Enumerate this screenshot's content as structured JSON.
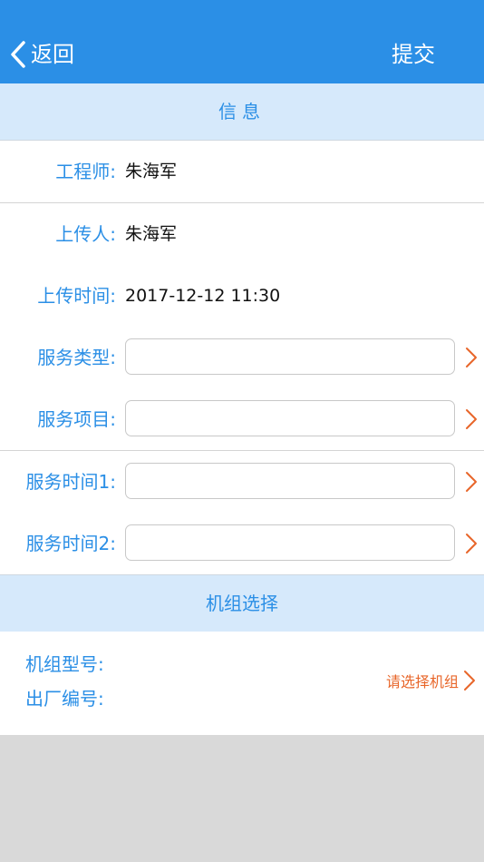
{
  "navbar": {
    "back_label": "返回",
    "submit_label": "提交"
  },
  "sections": {
    "info_title": "信息",
    "unit_title": "机组选择"
  },
  "info_rows": [
    {
      "label": "工程师:",
      "value": "朱海军"
    },
    {
      "label": "上传人:",
      "value": "朱海军"
    },
    {
      "label": "上传时间:",
      "value": "2017-12-12 11:30"
    }
  ],
  "input_rows": [
    {
      "label": "服务类型:",
      "value": "",
      "placeholder": ""
    },
    {
      "label": "服务项目:",
      "value": "",
      "placeholder": ""
    },
    {
      "label": "服务时间1:",
      "value": "",
      "placeholder": ""
    },
    {
      "label": "服务时间2:",
      "value": "",
      "placeholder": ""
    }
  ],
  "unit": {
    "model_label": "机组型号:",
    "serial_label": "出厂编号:",
    "choose_label": "请选择机组"
  },
  "colors": {
    "nav_bg": "#2b8fe6",
    "section_bg": "#d6e9fb",
    "label_blue": "#2b8fe6",
    "accent_orange": "#e8662a",
    "page_bg": "#d9d9d9"
  },
  "icons": {
    "back": "chevron-left-icon",
    "row_arrow": "chevron-right-icon"
  }
}
